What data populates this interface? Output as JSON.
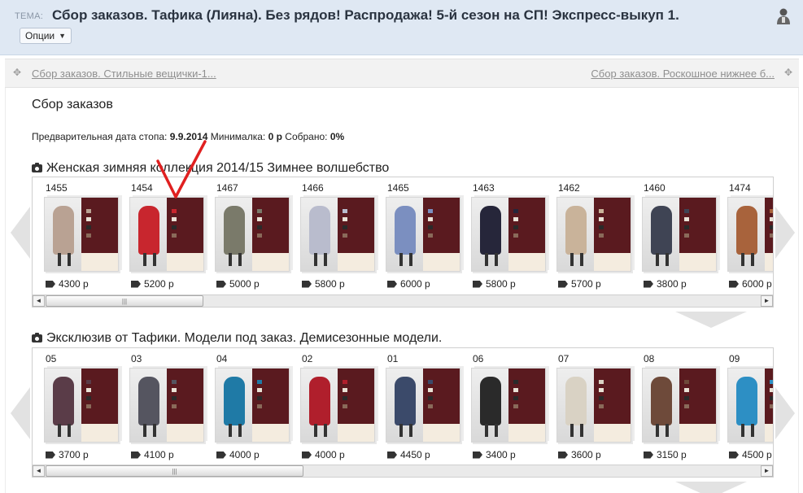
{
  "topic": {
    "label": "ТЕМА:",
    "title": "Сбор заказов. Тафика (Лияна). Без рядов! Распродажа! 5-й сезон на СП! Экспресс-выкуп 1.",
    "options_label": "Опции",
    "user_icon": "user-icon"
  },
  "nav": {
    "prev_link": "Сбор заказов. Стильные вещички-1...",
    "next_link": "Сбор заказов. Роскошное нижнее б..."
  },
  "collection": {
    "title": "Сбор заказов",
    "stop_label": "Предварительная дата стопа:",
    "stop_date": "9.9.2014",
    "min_label": "Минималка:",
    "min_value": "0 р",
    "collected_label": "Собрано:",
    "collected_value": "0%"
  },
  "albums": [
    {
      "title": "Женская зимняя коллекция 2014/15 Зимнее волшебство",
      "scroll_fraction": 0.22,
      "items": [
        {
          "code": "1455",
          "price": "4300 р",
          "color": "#b9a293"
        },
        {
          "code": "1454",
          "price": "5200 р",
          "color": "#c8262e"
        },
        {
          "code": "1467",
          "price": "5000 р",
          "color": "#7a7a6a"
        },
        {
          "code": "1466",
          "price": "5800 р",
          "color": "#b9bccd"
        },
        {
          "code": "1465",
          "price": "6000 р",
          "color": "#7b8fc0"
        },
        {
          "code": "1463",
          "price": "5800 р",
          "color": "#26263a"
        },
        {
          "code": "1462",
          "price": "5700 р",
          "color": "#c9b39a"
        },
        {
          "code": "1460",
          "price": "3800 р",
          "color": "#3f4454"
        },
        {
          "code": "1474",
          "price": "6000 р",
          "color": "#a8633c"
        }
      ]
    },
    {
      "title": "Эксклюзив от Тафики. Модели под заказ. Демисезонные модели.",
      "scroll_fraction": 0.36,
      "items": [
        {
          "code": "05",
          "price": "3700 р",
          "color": "#5a3c48"
        },
        {
          "code": "03",
          "price": "4100 р",
          "color": "#555560"
        },
        {
          "code": "04",
          "price": "4000 р",
          "color": "#1f7aa6"
        },
        {
          "code": "02",
          "price": "4000 р",
          "color": "#b01f2c"
        },
        {
          "code": "01",
          "price": "4450 р",
          "color": "#3b4a6a"
        },
        {
          "code": "06",
          "price": "3400 р",
          "color": "#2a2a2a"
        },
        {
          "code": "07",
          "price": "3600 р",
          "color": "#d9d2c4"
        },
        {
          "code": "08",
          "price": "3150 р",
          "color": "#6e4a3a"
        },
        {
          "code": "09",
          "price": "4500 р",
          "color": "#2d8fc4"
        }
      ]
    }
  ],
  "colors": {
    "header_bg": "#dfe8f3",
    "panel_bg": "#5a1a1f",
    "annotation": "#e02020"
  }
}
